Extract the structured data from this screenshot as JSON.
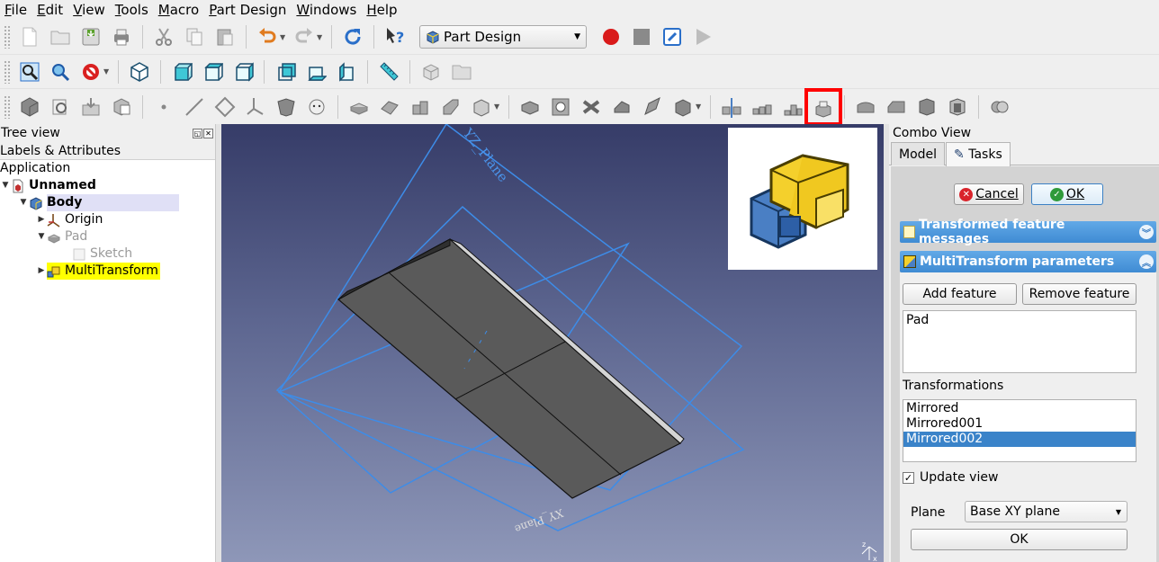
{
  "menu": {
    "items": [
      {
        "label": "File",
        "u": "F",
        "rest": "ile"
      },
      {
        "label": "Edit",
        "u": "E",
        "rest": "dit"
      },
      {
        "label": "View",
        "u": "V",
        "rest": "iew"
      },
      {
        "label": "Tools",
        "u": "T",
        "rest": "ools"
      },
      {
        "label": "Macro",
        "u": "M",
        "rest": "acro"
      },
      {
        "label": "Part Design",
        "u": "P",
        "rest": "art Design"
      },
      {
        "label": "Windows",
        "u": "W",
        "rest": "indows"
      },
      {
        "label": "Help",
        "u": "H",
        "rest": "elp"
      }
    ]
  },
  "workbench": {
    "selected": "Part Design"
  },
  "tree": {
    "title": "Tree view",
    "header": "Labels & Attributes",
    "root": "Application",
    "document": "Unnamed",
    "body": "Body",
    "origin": "Origin",
    "pad": "Pad",
    "sketch": "Sketch",
    "multitransform": "MultiTransform"
  },
  "viewport": {
    "plane_label_top": "YZ_Plane",
    "plane_label_bottom": "XY_Plane"
  },
  "combo": {
    "title": "Combo View",
    "tab_model": "Model",
    "tab_tasks": "Tasks",
    "cancel": "Cancel",
    "ok": "OK",
    "messages_header": "Transformed feature messages",
    "params_header": "MultiTransform parameters",
    "add_feature": "Add feature",
    "remove_feature": "Remove feature",
    "features": [
      "Pad"
    ],
    "transformations_label": "Transformations",
    "transformations": [
      "Mirrored",
      "Mirrored001",
      "Mirrored002"
    ],
    "update_view": "Update view",
    "plane_label": "Plane",
    "plane_value": "Base XY plane",
    "ok_bottom": "OK"
  }
}
